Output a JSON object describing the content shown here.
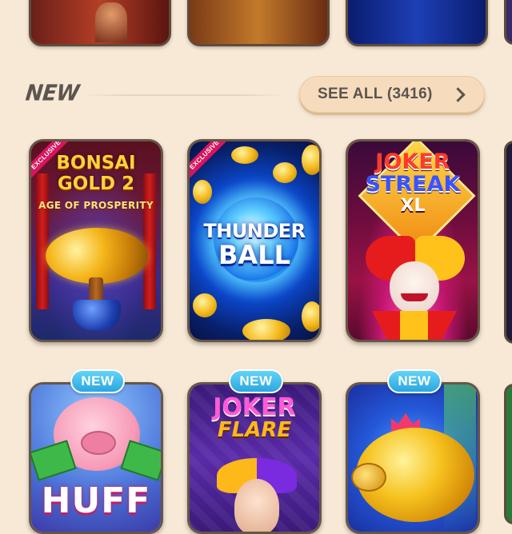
{
  "section": {
    "title": "NEW",
    "see_all_label": "SEE ALL (3416)"
  },
  "games_row1": [
    {
      "title_line1": "BONSAI",
      "title_line2": "GOLD 2",
      "subtitle": "AGE OF PROSPERITY",
      "tag": "EXCLUSIVE"
    },
    {
      "title_line1": "THUNDER",
      "title_line2": "BALL",
      "tag": "EXCLUSIVE"
    },
    {
      "title_line1": "JOKER",
      "title_line2": "STREAK",
      "subtitle": "XL"
    }
  ],
  "games_row2": [
    {
      "badge": "NEW",
      "title_line1": "HUFF"
    },
    {
      "badge": "NEW",
      "title_line1": "JOKER",
      "title_line2": "FLARE"
    },
    {
      "badge": "NEW",
      "title_line1": ""
    }
  ],
  "icons": [
    "chevron-right-icon",
    "bonsai-tree",
    "thunder-orb",
    "joker-face",
    "pig-mascot",
    "joker-mascot",
    "golden-piggy-bank"
  ],
  "colors": {
    "background": "#f8e9d6",
    "see_all_bg": "#f6dcbc",
    "badge_new": "#2aa6e1",
    "card_border": "#675546"
  }
}
